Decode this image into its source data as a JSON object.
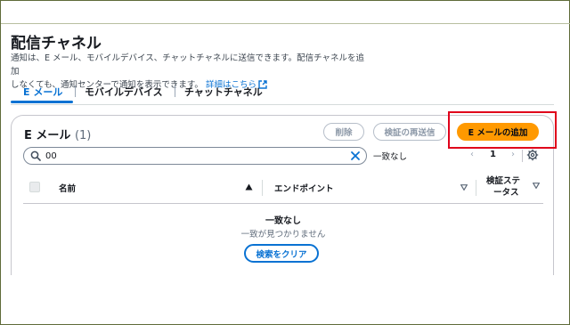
{
  "header": {
    "title": "配信チャネル",
    "description_line1": "通知は、E メール、モバイルデバイス、チャットチャネルに送信できます。配信チャネルを追加",
    "description_line2": "しなくても、通知センターで通知を表示できます。",
    "details_link": "詳細はこちら"
  },
  "tabs": [
    {
      "label": "E メール",
      "active": true
    },
    {
      "label": "モバイルデバイス",
      "active": false
    },
    {
      "label": "チャットチャネル",
      "active": false
    }
  ],
  "panel": {
    "title": "E メール",
    "count": "(1)",
    "delete_button": "削除",
    "resend_button": "検証の再送信",
    "add_button": "E メールの追加"
  },
  "search": {
    "value": "00",
    "match_text": "一致なし"
  },
  "pagination": {
    "current_page": "1"
  },
  "table": {
    "columns": [
      "名前",
      "エンドポイント",
      "検証ステ",
      "ータス"
    ]
  },
  "empty_state": {
    "title": "一致なし",
    "subtitle": "一致が見つかりません",
    "clear_button": "検索をクリア"
  },
  "colors": {
    "accent": "#0972d3",
    "primary_button": "#ff9900",
    "highlight": "#e0001b"
  }
}
